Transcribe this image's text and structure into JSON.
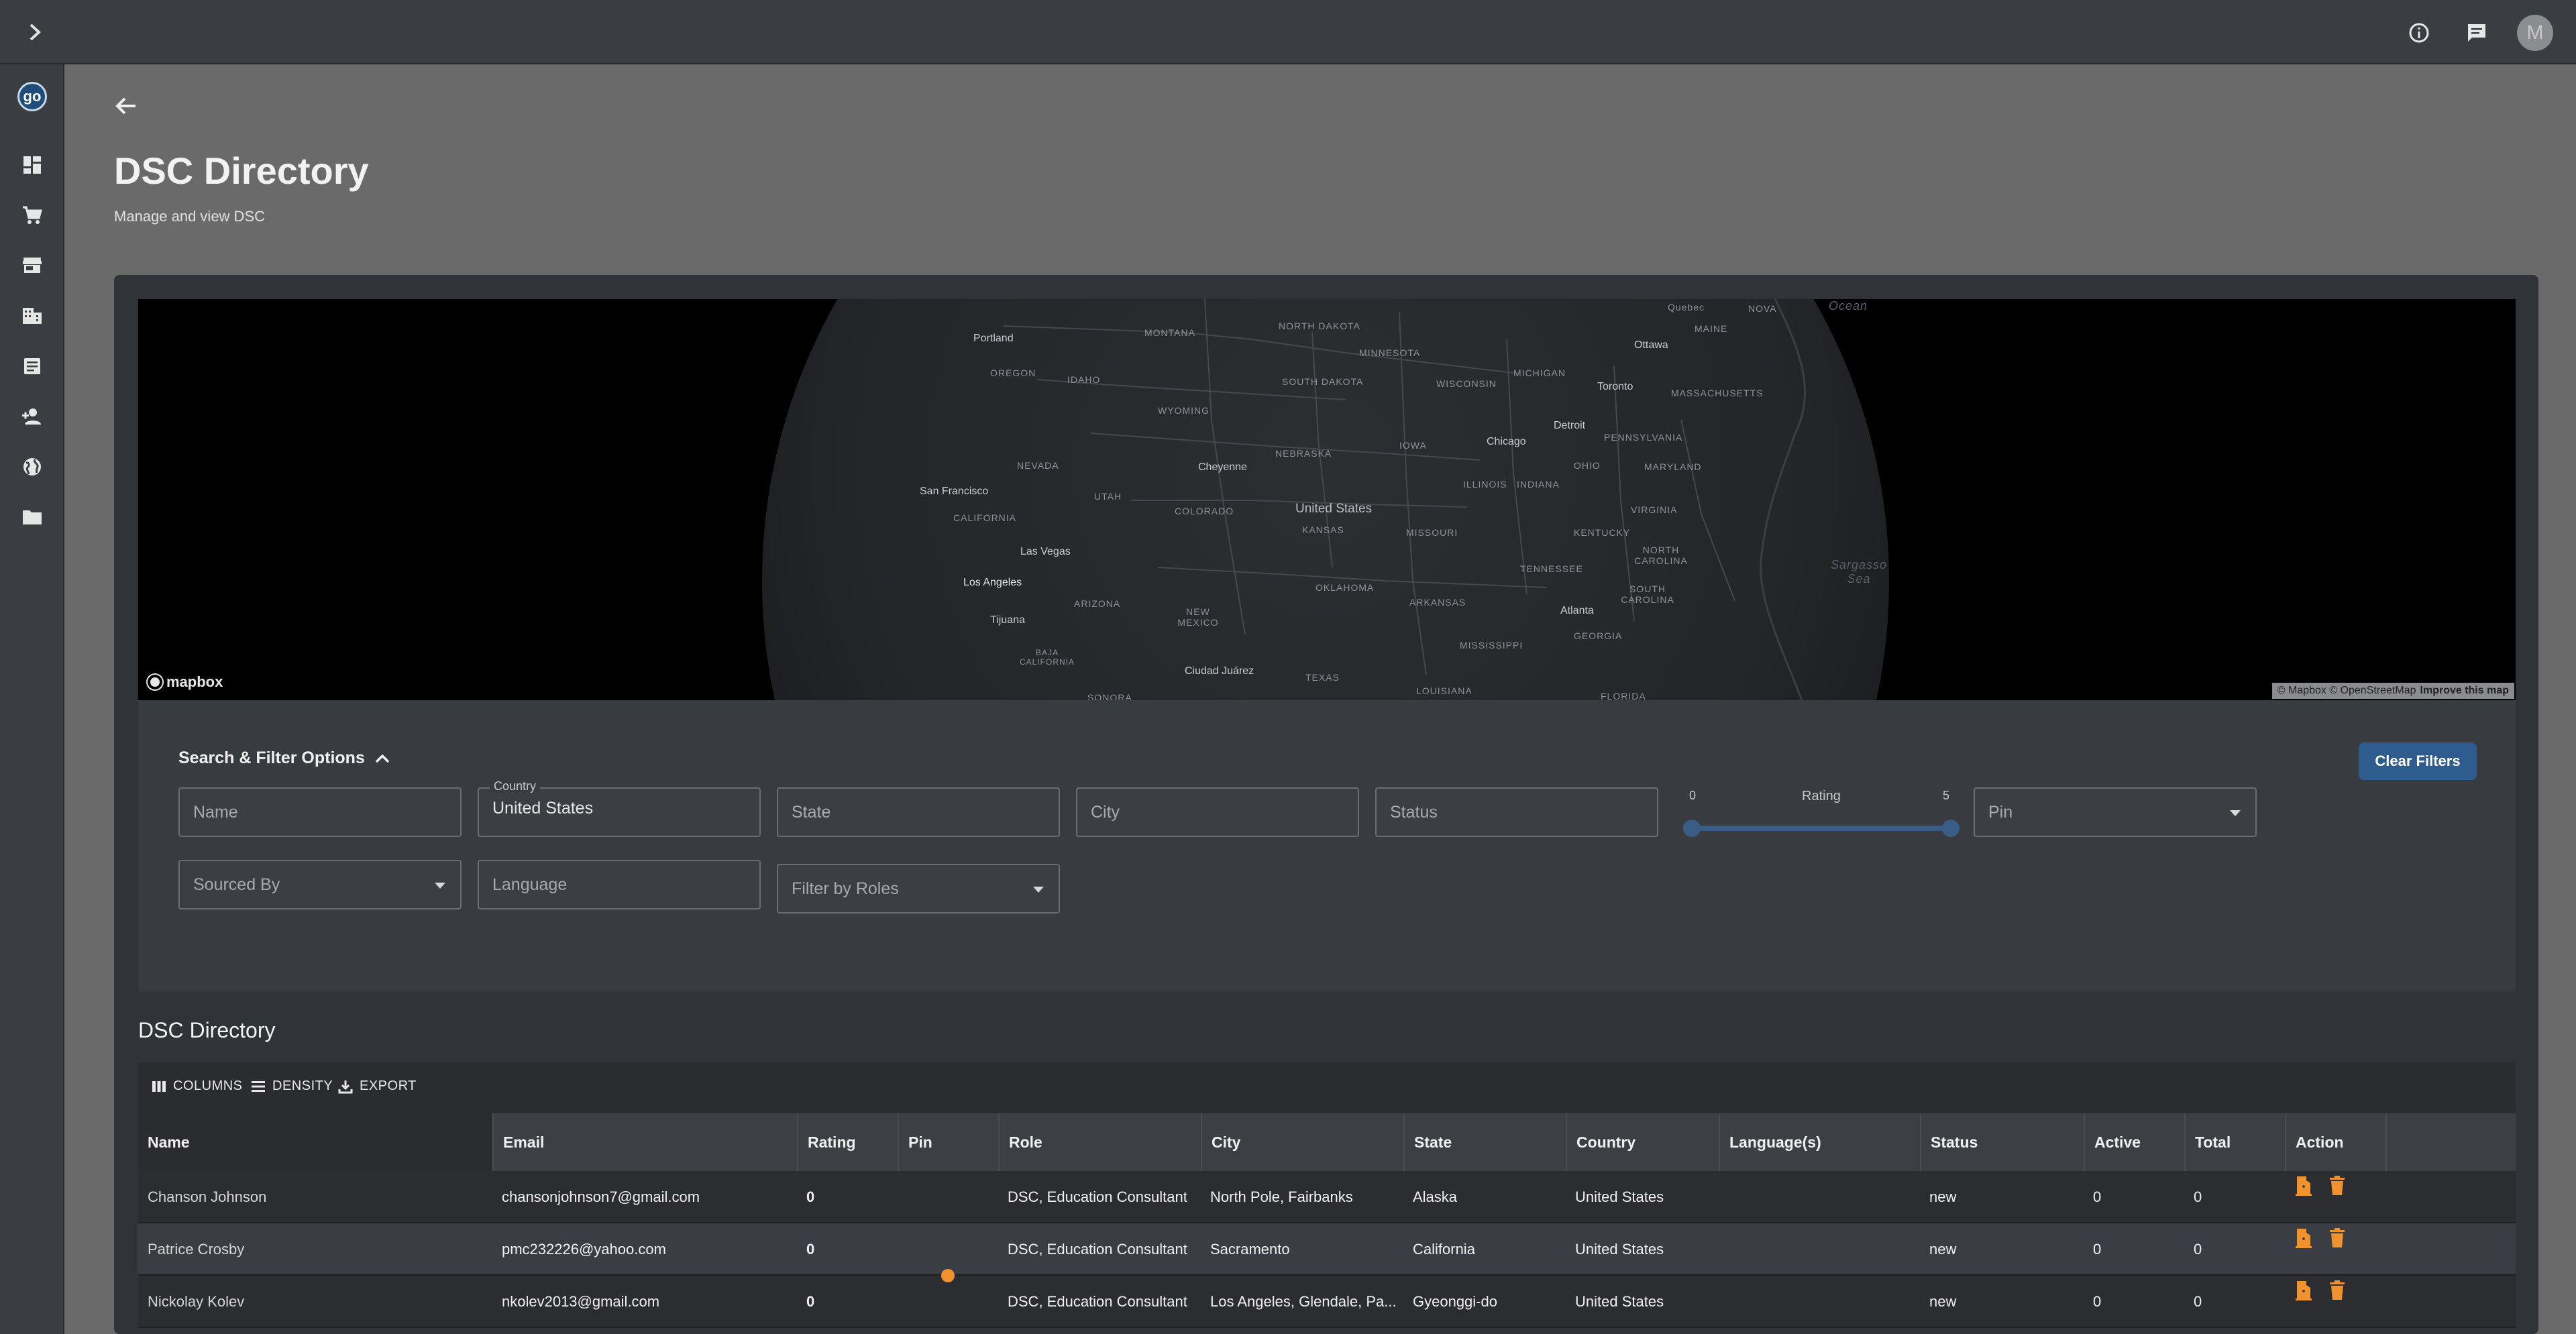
{
  "page": {
    "title": "DSC Directory",
    "subtitle": "Manage and view DSC"
  },
  "topbar": {
    "avatar_initial": "M",
    "icons": [
      "chevron-right-icon",
      "info-icon",
      "feedback-icon",
      "avatar"
    ]
  },
  "sidebar": {
    "logo_text": "go",
    "items": [
      {
        "icon": "dashboard-icon"
      },
      {
        "icon": "cart-icon"
      },
      {
        "icon": "store-icon"
      },
      {
        "icon": "building-icon"
      },
      {
        "icon": "document-icon"
      },
      {
        "icon": "add-person-icon"
      },
      {
        "icon": "globe-icon"
      },
      {
        "icon": "folder-icon"
      }
    ]
  },
  "map": {
    "logo": "mapbox",
    "attribution": "© Mapbox © OpenStreetMap",
    "improve": "Improve this map",
    "labels": {
      "quebec": "Quebec",
      "nova": "NOVA",
      "maine": "MAINE",
      "ocean": "Ocean",
      "portland": "Portland",
      "montana": "MONTANA",
      "north_dakota": "NORTH DAKOTA",
      "minnesota": "MINNESOTA",
      "ottawa": "Ottawa",
      "oregon": "OREGON",
      "idaho": "IDAHO",
      "south_dakota": "SOUTH DAKOTA",
      "wisconsin": "WISCONSIN",
      "michigan": "MICHIGAN",
      "toronto": "Toronto",
      "massachusetts": "MASSACHUSETTS",
      "wyoming": "WYOMING",
      "detroit": "Detroit",
      "pennsylvania": "PENNSYLVANIA",
      "iowa": "IOWA",
      "chicago": "Chicago",
      "nebraska": "NEBRASKA",
      "nevada": "NEVADA",
      "cheyenne": "Cheyenne",
      "ohio": "OHIO",
      "maryland": "MARYLAND",
      "illinois": "ILLINOIS",
      "indiana": "INDIANA",
      "san_francisco": "San Francisco",
      "utah": "UTAH",
      "united_states": "United States",
      "colorado": "COLORADO",
      "california": "CALIFORNIA",
      "kansas": "KANSAS",
      "virginia": "VIRGINIA",
      "missouri": "MISSOURI",
      "kentucky": "KENTUCKY",
      "las_vegas": "Las Vegas",
      "north_carolina": "NORTH CAROLINA",
      "tennessee": "TENNESSEE",
      "sargasso": "Sargasso Sea",
      "los_angeles": "Los Angeles",
      "oklahoma": "OKLAHOMA",
      "arizona": "ARIZONA",
      "arkansas": "ARKANSAS",
      "south_carolina": "SOUTH CAROLINA",
      "new_mexico": "NEW MEXICO",
      "atlanta": "Atlanta",
      "tijuana": "Tijuana",
      "georgia": "GEORGIA",
      "mississippi": "MISSISSIPPI",
      "baja": "BAJA CALIFORNIA",
      "ciudad_juarez": "Ciudad Juárez",
      "texas": "TEXAS",
      "sonora": "SONORA",
      "louisiana": "LOUISIANA",
      "florida": "FLORIDA"
    }
  },
  "filters": {
    "section_title": "Search & Filter Options",
    "clear_label": "Clear Filters",
    "name_placeholder": "Name",
    "country_label": "Country",
    "country_value": "United States",
    "state_placeholder": "State",
    "city_placeholder": "City",
    "status_placeholder": "Status",
    "rating_label": "Rating",
    "rating_min": "0",
    "rating_max": "5",
    "rating_range": [
      0,
      5
    ],
    "pin_placeholder": "Pin",
    "sourced_by_placeholder": "Sourced By",
    "language_placeholder": "Language",
    "roles_placeholder": "Filter by Roles"
  },
  "grid": {
    "title": "DSC Directory",
    "toolbar": {
      "columns": "COLUMNS",
      "density": "DENSITY",
      "export": "EXPORT"
    },
    "columns": [
      "Name",
      "Email",
      "Rating",
      "Pin",
      "Role",
      "City",
      "State",
      "Country",
      "Language(s)",
      "Status",
      "Active",
      "Total",
      "Action"
    ],
    "rows": [
      {
        "name": "Chanson Johnson",
        "email": "chansonjohnson7@gmail.com",
        "rating": "0",
        "pin": false,
        "role": "DSC, Education Consultant",
        "city": "North Pole, Fairbanks",
        "state": "Alaska",
        "country": "United States",
        "languages": "",
        "status": "new",
        "active": "0",
        "total": "0"
      },
      {
        "name": "Patrice Crosby",
        "email": "pmc232226@yahoo.com",
        "rating": "0",
        "pin": false,
        "role": "DSC, Education Consultant",
        "city": "Sacramento",
        "state": "California",
        "country": "United States",
        "languages": "",
        "status": "new",
        "active": "0",
        "total": "0"
      },
      {
        "name": "Nickolay Kolev",
        "email": "nkolev2013@gmail.com",
        "rating": "0",
        "pin": true,
        "role": "DSC, Education Consultant",
        "city": "Los Angeles, Glendale, Pa...",
        "state": "Gyeonggi-do",
        "country": "United States",
        "languages": "",
        "status": "new",
        "active": "0",
        "total": "0"
      }
    ]
  },
  "colors": {
    "accent": "#2f5c8f",
    "action_icon": "#f0922e",
    "pin_dot": "#f0922e",
    "background": "#6a6a6a",
    "panel": "#303338"
  }
}
